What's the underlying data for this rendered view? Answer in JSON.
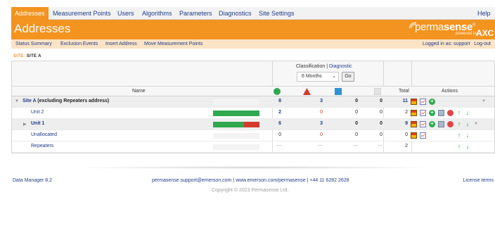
{
  "nav": {
    "items": [
      "Addresses",
      "Measurement Points",
      "Users",
      "Algorithms",
      "Parameters",
      "Diagnostics",
      "Site Settings"
    ],
    "help": "Help"
  },
  "banner": {
    "title": "Addresses",
    "logo_prefix": "perma",
    "logo_bold": "sense",
    "logo_suffix": "AXC",
    "logo_powered": "powered by",
    "reg": "®"
  },
  "subnav": {
    "items": [
      "Status Summary",
      "Exclusion Events",
      "Insert Address",
      "Move Measurement Points"
    ],
    "logged_in_label": "Logged in as:",
    "user": "support",
    "logout": "Log-out"
  },
  "site": {
    "label": "SITE:",
    "name": "SITE A"
  },
  "classification": {
    "label": "Classification",
    "separator": "|",
    "diagnostic": "Diagnostic",
    "period": "6 Months",
    "go": "Go"
  },
  "columns": {
    "name": "Name",
    "total": "Total",
    "actions": "Actions"
  },
  "colors": {
    "ok": "#2fa84f",
    "warning": "#d23a2c",
    "info": "#2e93d6",
    "unknown": "#d9d9d9",
    "accent": "#f39320"
  },
  "rows": [
    {
      "name": "Site A",
      "name_suffix": "(excluding Repeaters address)",
      "green": "8",
      "red": "3",
      "blue": "0",
      "grey": "0",
      "total": "11",
      "bar_ok": 0,
      "bar_warn": 0
    },
    {
      "name": "Unit 2",
      "green": "2",
      "red": "0",
      "blue": "0",
      "grey": "0",
      "total": "2",
      "bar_ok": 1.0,
      "bar_warn": 0
    },
    {
      "name": "Unit 1",
      "green": "6",
      "red": "3",
      "blue": "0",
      "grey": "0",
      "total": "9",
      "bar_ok": 0.67,
      "bar_warn": 0.33
    },
    {
      "name": "Unallocated",
      "green": "0",
      "red": "0",
      "blue": "0",
      "grey": "0",
      "total": "0",
      "bar_ok": 0,
      "bar_warn": 0
    },
    {
      "name": "Repeaters",
      "green": "---",
      "red": "---",
      "blue": "---",
      "grey": "---",
      "total": "2",
      "bar_ok": 0,
      "bar_warn": 0
    }
  ],
  "footer": {
    "version": "Data Manager 8.2",
    "email": "permasense.support@emerson.com",
    "sep1": "|",
    "website": "www.emerson.com/permasense",
    "sep2": "|",
    "phone": "+44 11 6282 2628",
    "license": "License terms",
    "copyright": "Copyright © 2023 Permasense Ltd."
  }
}
